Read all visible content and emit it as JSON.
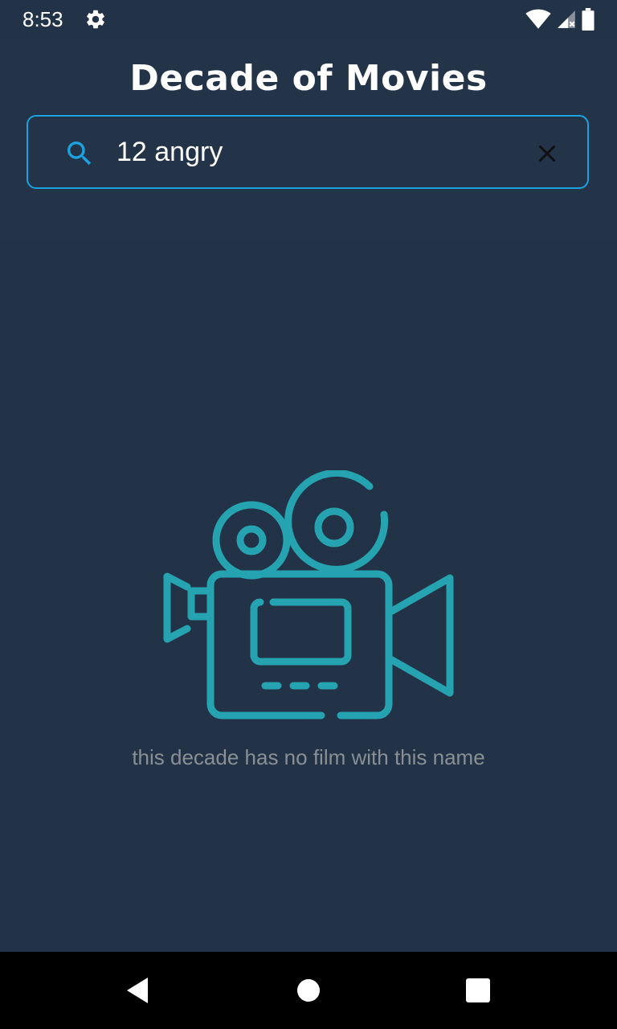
{
  "status_bar": {
    "time": "8:53",
    "icons": [
      "gear-icon",
      "wifi-icon",
      "signal-icon",
      "battery-icon"
    ]
  },
  "header": {
    "title": "Decade of Movies"
  },
  "search": {
    "value": "12 angry",
    "icon": "search-icon",
    "clear_icon": "close-icon"
  },
  "empty_state": {
    "icon": "movie-camera-icon",
    "message": "this decade has no film with this name"
  },
  "nav_bar": {
    "buttons": [
      "back-icon",
      "home-icon",
      "recents-icon"
    ]
  },
  "colors": {
    "background": "#233347",
    "accent": "#1da2e0",
    "illustration": "#26a3b0",
    "muted_text": "#8a8f96"
  }
}
